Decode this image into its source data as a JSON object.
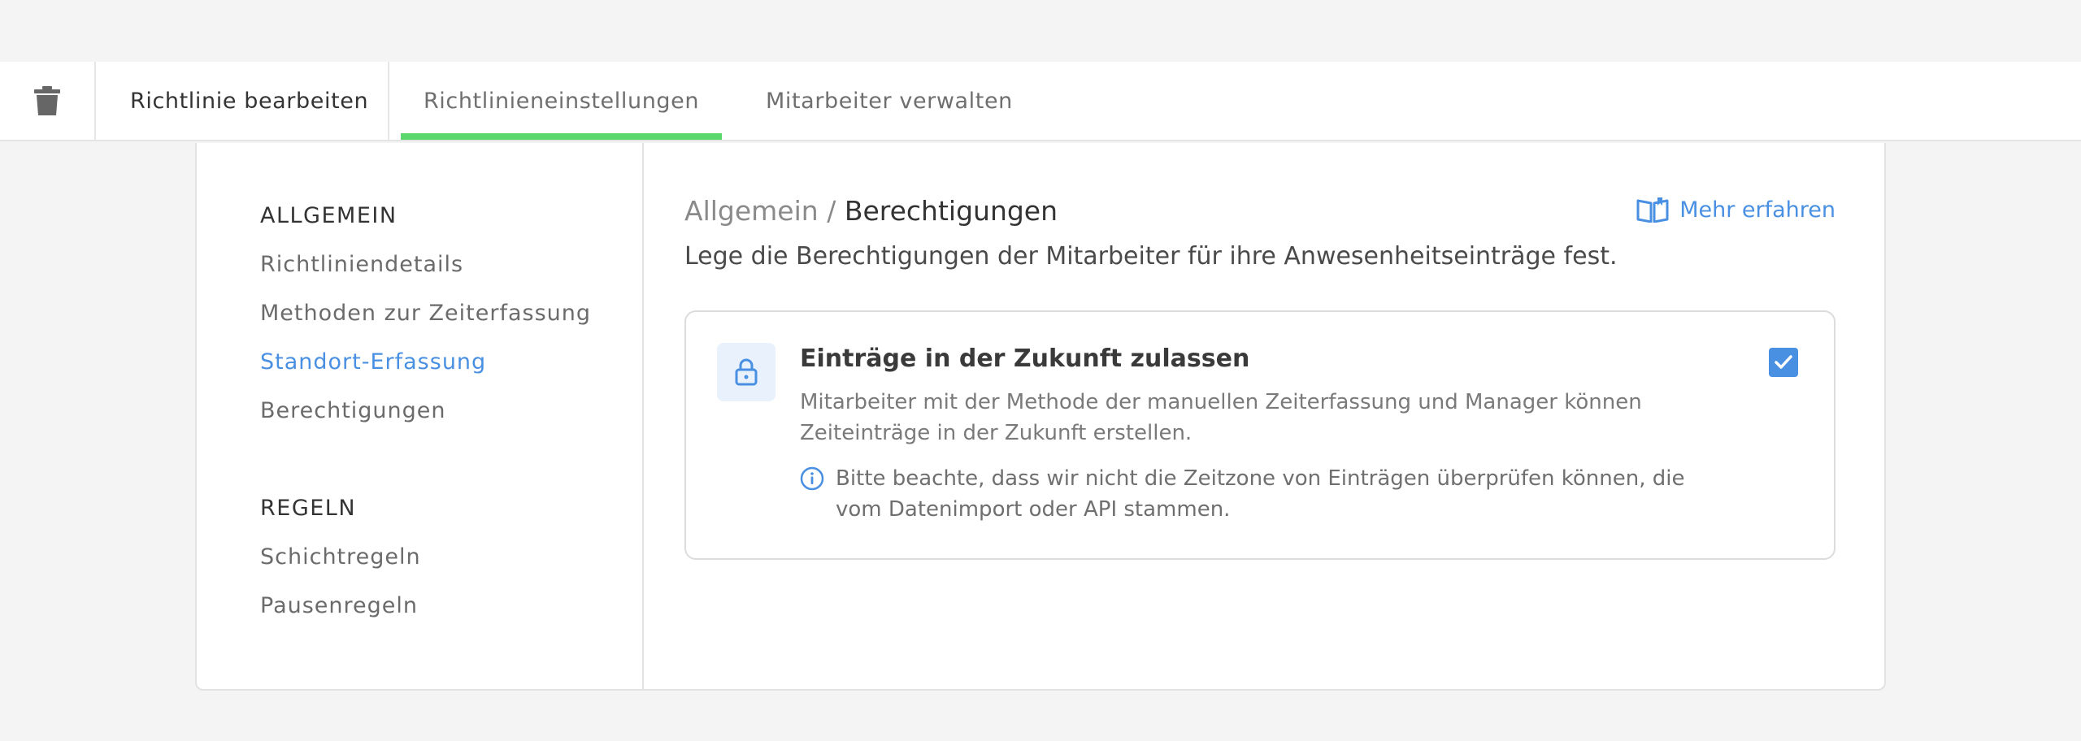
{
  "tabs": {
    "delete_icon": "trash-icon",
    "edit_label": "Richtlinie bearbeiten",
    "settings_label": "Richtlinieneinstellungen",
    "employees_label": "Mitarbeiter verwalten",
    "active_color": "#5ad86c"
  },
  "sidebar": {
    "general_title": "ALLGEMEIN",
    "general_items": [
      {
        "label": "Richtliniendetails"
      },
      {
        "label": "Methoden zur Zeiterfassung"
      },
      {
        "label": "Standort-Erfassung",
        "active": true
      },
      {
        "label": "Berechtigungen"
      }
    ],
    "rules_title": "REGELN",
    "rules_items": [
      {
        "label": "Schichtregeln"
      },
      {
        "label": "Pausenregeln"
      }
    ],
    "active_color": "#4a90e2"
  },
  "content": {
    "breadcrumb_parent": "Allgemein",
    "breadcrumb_separator": "/",
    "breadcrumb_current": "Berechtigungen",
    "learn_more_label": "Mehr erfahren",
    "learn_more_icon": "open-book-icon",
    "description": "Lege die Berechtigungen der Mitarbeiter für ihre Anwesenheitseinträge fest.",
    "setting": {
      "icon": "lock-icon",
      "title": "Einträge in der Zukunft zulassen",
      "description": "Mitarbeiter mit der Methode der manuellen Zeiterfassung und Manager können Zeiteinträge in der Zukunft erstellen.",
      "info_icon": "info-icon",
      "info": "Bitte beachte, dass wir nicht die Zeitzone von Einträgen überprüfen können, die vom Datenimport oder API stammen.",
      "checked": true
    }
  }
}
